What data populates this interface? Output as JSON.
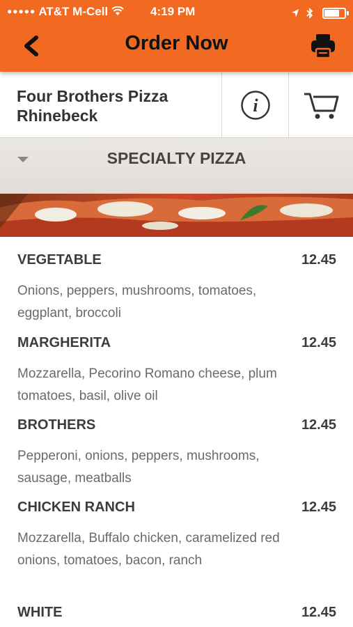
{
  "status_bar": {
    "carrier": "AT&T M-Cell",
    "time": "4:19 PM",
    "battery_level": 0.75
  },
  "header": {
    "title": "Order Now",
    "back_icon": "chevron-left-icon",
    "print_icon": "printer-icon",
    "background_color": "#f26a22"
  },
  "store": {
    "name": "Four Brothers Pizza Rhinebeck",
    "info_icon": "info-icon",
    "cart_icon": "cart-icon"
  },
  "category": {
    "label": "SPECIALTY PIZZA",
    "expanded": true
  },
  "menu_items": [
    {
      "name": "VEGETABLE",
      "price": "12.45",
      "description": "Onions, peppers, mushrooms, tomatoes, eggplant, broccoli"
    },
    {
      "name": "MARGHERITA",
      "price": "12.45",
      "description": "Mozzarella, Pecorino Romano cheese, plum tomatoes, basil, olive oil"
    },
    {
      "name": "BROTHERS",
      "price": "12.45",
      "description": "Pepperoni, onions, peppers, mushrooms, sausage, meatballs"
    },
    {
      "name": "CHICKEN RANCH",
      "price": "12.45",
      "description": "Mozzarella, Buffalo chicken, caramelized red onions, tomatoes, bacon, ranch"
    },
    {
      "name": "WHITE",
      "price": "12.45",
      "description": ""
    }
  ]
}
